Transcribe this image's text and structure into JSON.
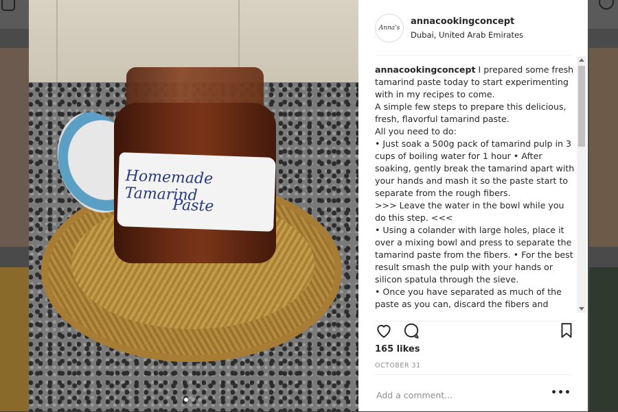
{
  "post": {
    "username": "annacookingconcept",
    "location": "Dubai, United Arab Emirates",
    "avatar_text": "Anna's",
    "photo_label": [
      "Homemade Tamarind",
      "Paste"
    ],
    "caption_lines": [
      " I prepared some fresh tamarind paste today to start experimenting with in my recipes to come.",
      "A simple few steps to prepare this delicious, fresh, flavorful tamarind paste.",
      "All you need to do:",
      "• Just soak a 500g pack of tamarind pulp in 3 cups of boiling water for 1 hour • After soaking, gently break the tamarind apart with your hands and mash it so the paste start to separate from the rough fibers.",
      ">>> Leave the water in the bowl while you do this step. <<<",
      "• Using a colander with large holes, place it over a mixing bowl and press to separate the tamarind paste from the fibers. • For the best result smash the pulp with your hands or silicon spatula through the sieve.",
      "• Once you have separated as much of the paste as you can, discard the fibers and"
    ],
    "likes": "165 likes",
    "date": "OCTOBER 31",
    "comment_placeholder": "Add a comment...",
    "more_label": "•••",
    "carousel": {
      "count": 3,
      "active": 1
    }
  },
  "icons": {
    "like": "heart-icon",
    "comment": "comment-icon",
    "save": "bookmark-icon"
  }
}
